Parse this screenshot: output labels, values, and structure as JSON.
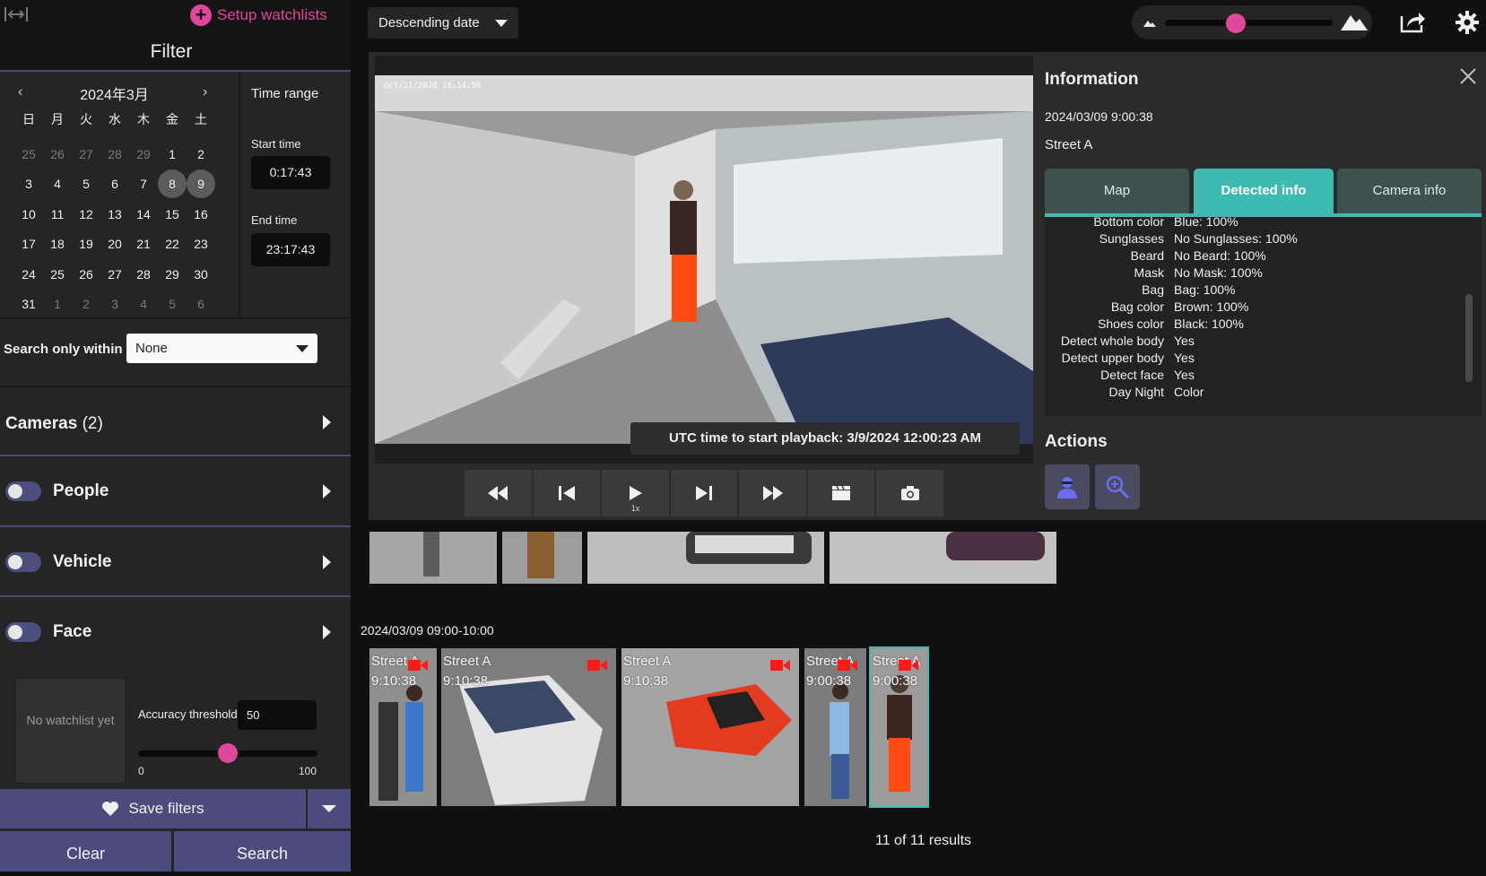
{
  "left": {
    "setup_watchlists": "Setup watchlists",
    "filter_title": "Filter",
    "calendar": {
      "month": "2024年3月",
      "weekdays": [
        "日",
        "月",
        "火",
        "水",
        "木",
        "金",
        "土"
      ],
      "weeks": [
        [
          "25",
          "26",
          "27",
          "28",
          "29",
          "1",
          "2"
        ],
        [
          "3",
          "4",
          "5",
          "6",
          "7",
          "8",
          "9"
        ],
        [
          "10",
          "11",
          "12",
          "13",
          "14",
          "15",
          "16"
        ],
        [
          "17",
          "18",
          "19",
          "20",
          "21",
          "22",
          "23"
        ],
        [
          "24",
          "25",
          "26",
          "27",
          "28",
          "29",
          "30"
        ],
        [
          "31",
          "1",
          "2",
          "3",
          "4",
          "5",
          "6"
        ]
      ],
      "selected": [
        "8",
        "9"
      ]
    },
    "time_range": {
      "title": "Time range",
      "start_label": "Start time",
      "start_value": "0:17:43",
      "end_label": "End time",
      "end_value": "23:17:43"
    },
    "search_within": {
      "label": "Search only within",
      "value": "None"
    },
    "cameras": {
      "label": "Cameras",
      "count": "(2)"
    },
    "people": {
      "label": "People",
      "enabled": false
    },
    "vehicle": {
      "label": "Vehicle",
      "enabled": false
    },
    "face": {
      "label": "Face",
      "enabled": false,
      "watchlist_empty": "No watchlist yet",
      "accuracy_label": "Accuracy threshold",
      "accuracy_value": "50",
      "accuracy_fraction": 0.5,
      "min": "0",
      "max": "100"
    },
    "save_filters": "Save filters",
    "clear": "Clear",
    "search": "Search"
  },
  "topbar": {
    "sort": "Descending date",
    "zoom_fraction": 0.42
  },
  "viewer": {
    "video_timestamp": "Oct/21/2020 15:14:56",
    "playback_banner": "UTC time to start playback: 3/9/2024 12:00:23 AM",
    "speed": "1x"
  },
  "info": {
    "title": "Information",
    "date": "2024/03/09 9:00:38",
    "location": "Street A",
    "tabs": [
      "Map",
      "Detected info",
      "Camera info"
    ],
    "active_tab": 1,
    "attributes": [
      {
        "k": "Bottom color",
        "v": "Blue: 100%"
      },
      {
        "k": "Sunglasses",
        "v": "No Sunglasses: 100%"
      },
      {
        "k": "Beard",
        "v": "No Beard: 100%"
      },
      {
        "k": "Mask",
        "v": "No Mask: 100%"
      },
      {
        "k": "Bag",
        "v": "Bag: 100%"
      },
      {
        "k": "Bag color",
        "v": "Brown: 100%"
      },
      {
        "k": "Shoes color",
        "v": "Black: 100%"
      },
      {
        "k": "Detect whole body",
        "v": "Yes"
      },
      {
        "k": "Detect upper body",
        "v": "Yes"
      },
      {
        "k": "Detect face",
        "v": "Yes"
      },
      {
        "k": "Day Night",
        "v": "Color"
      }
    ],
    "actions_title": "Actions"
  },
  "results": {
    "group_label": "2024/03/09 09:00-10:00",
    "items": [
      {
        "camera": "Street A",
        "time": "9:10:38"
      },
      {
        "camera": "Street A",
        "time": "9:10:38"
      },
      {
        "camera": "Street A",
        "time": "9:10:38"
      },
      {
        "camera": "Street A",
        "time": "9:00:38"
      },
      {
        "camera": "Street A",
        "time": "9:00:38"
      }
    ],
    "count": "11 of 11 results"
  },
  "colors": {
    "accent_pink": "#e0469b",
    "accent_teal": "#3dbab1",
    "panel_purple": "#4d4b7d"
  }
}
